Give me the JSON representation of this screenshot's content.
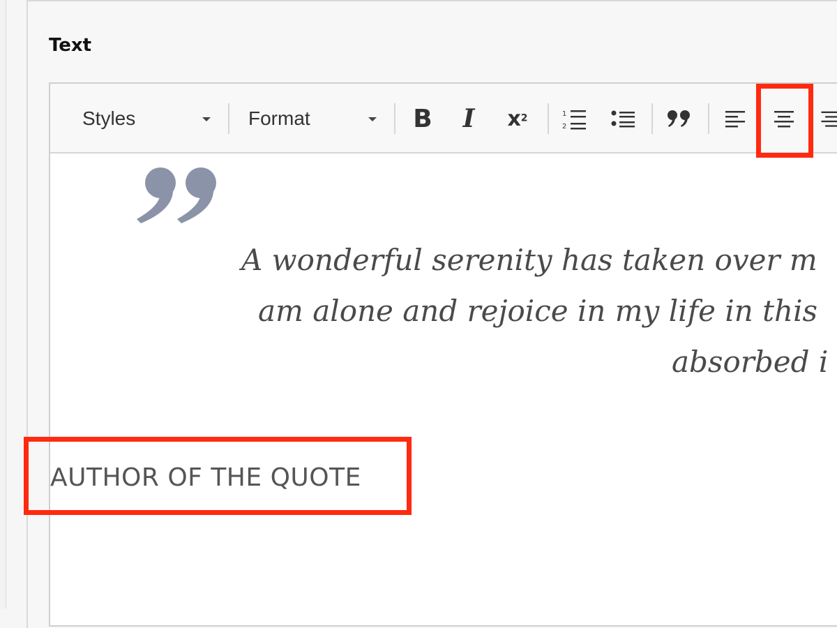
{
  "field": {
    "label": "Text"
  },
  "toolbar": {
    "styles_label": "Styles",
    "format_label": "Format",
    "bold_label": "B",
    "italic_label": "I",
    "superscript_label": "x",
    "superscript_exp": "2",
    "blockquote_label": "99"
  },
  "content": {
    "quote_lines": [
      "A wonderful serenity has taken over m",
      "am alone and rejoice in my life in this",
      "absorbed i"
    ],
    "author": "AUTHOR OF THE QUOTE"
  },
  "colors": {
    "highlight": "#ff2a10",
    "quote_mark": "#8a93a8",
    "quote_text": "#4a4a4a"
  },
  "icons": {
    "quote_mark": "closing-quote-icon",
    "align_center": "align-center-icon"
  }
}
